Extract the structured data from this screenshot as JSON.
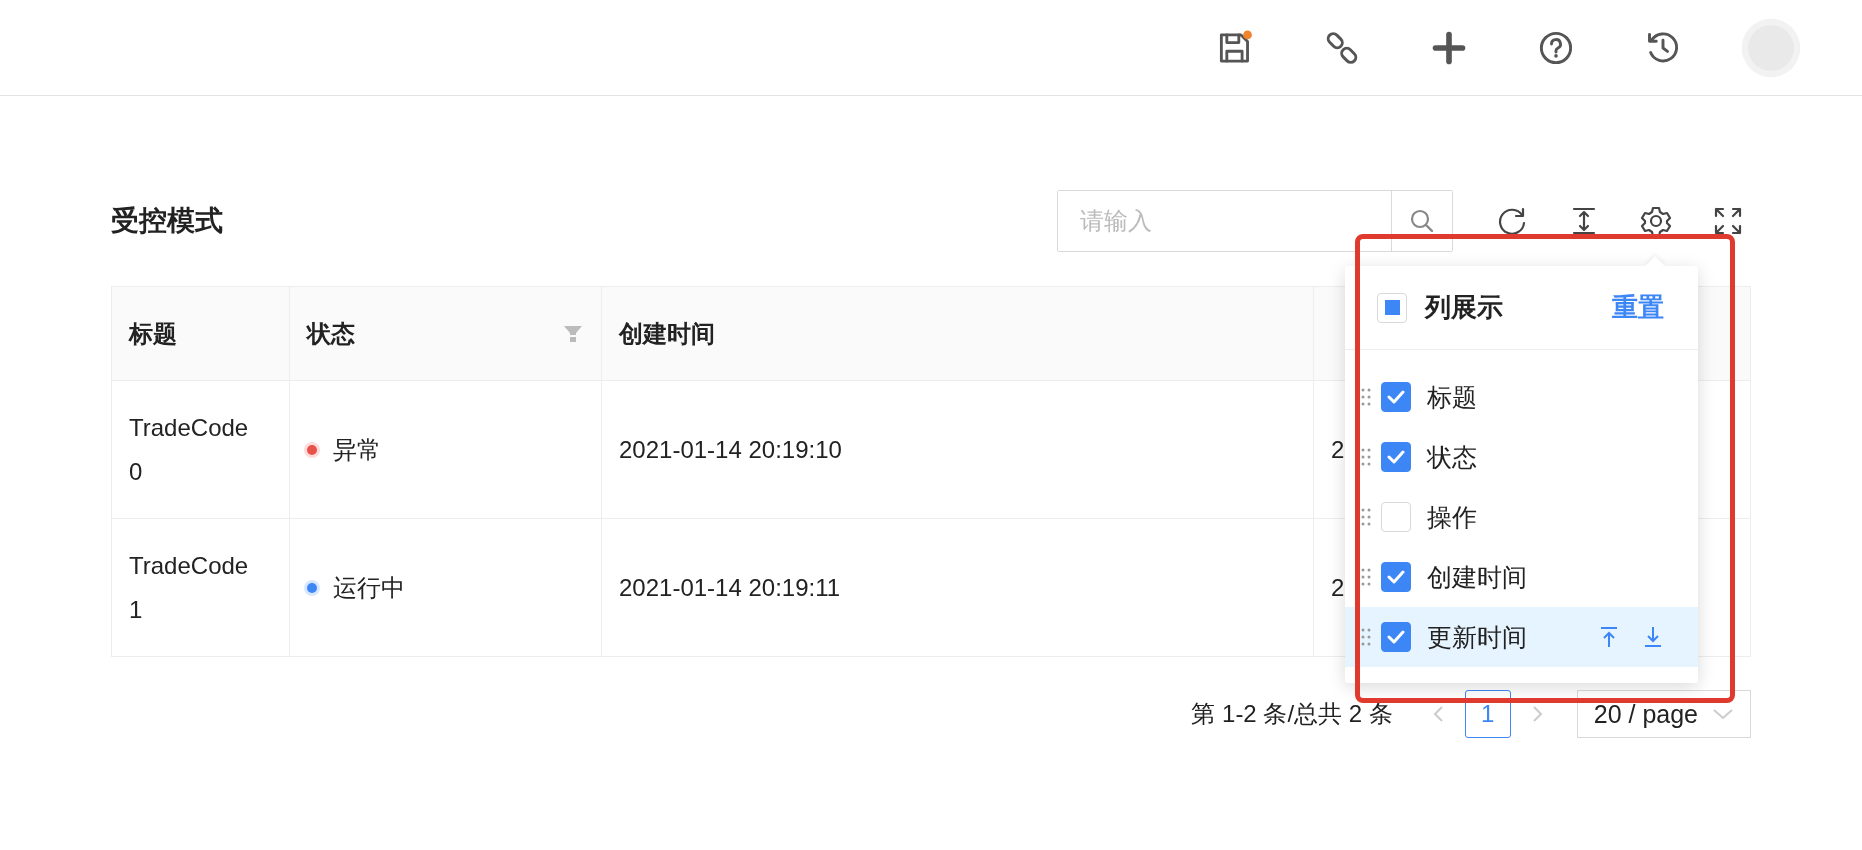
{
  "header": {
    "save_badge": true
  },
  "title": "受控模式",
  "search": {
    "placeholder": "请输入"
  },
  "table": {
    "columns": [
      {
        "label": "标题",
        "filter": false
      },
      {
        "label": "状态",
        "filter": true
      },
      {
        "label": "创建时间",
        "filter": false
      },
      {
        "filter": false
      }
    ],
    "rows": [
      {
        "title": "TradeCode 0",
        "status": {
          "text": "异常",
          "color": "#e8524a"
        },
        "created": "2021-01-14 20:19:10",
        "updated": "2"
      },
      {
        "title": "TradeCode 1",
        "status": {
          "text": "运行中",
          "color": "#3d86f5"
        },
        "created": "2021-01-14 20:19:11",
        "updated": "2"
      }
    ]
  },
  "pagination": {
    "summary": "第 1-2 条/总共 2 条",
    "pages": [
      {
        "label": "1",
        "selected": true
      }
    ],
    "page_size": "20 / page"
  },
  "column_settings": {
    "title": "列展示",
    "reset": "重置",
    "indeterminate": true,
    "items": [
      {
        "label": "标题",
        "checked": true,
        "hovered": false
      },
      {
        "label": "状态",
        "checked": true,
        "hovered": false
      },
      {
        "label": "操作",
        "checked": false,
        "hovered": false
      },
      {
        "label": "创建时间",
        "checked": true,
        "hovered": false
      },
      {
        "label": "更新时间",
        "checked": true,
        "hovered": true
      }
    ]
  }
}
